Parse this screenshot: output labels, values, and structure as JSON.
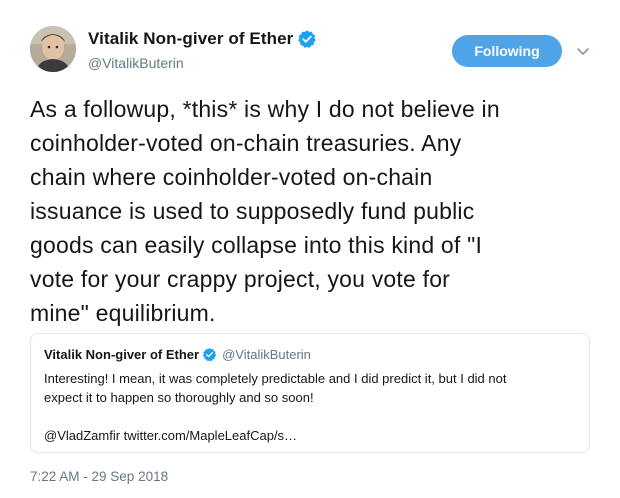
{
  "author": {
    "display_name": "Vitalik Non-giver of Ether",
    "handle": "@VitalikButerin",
    "verified": true
  },
  "follow_button": {
    "label": "Following",
    "color": "#4ea4e7"
  },
  "tweet": {
    "lines": [
      "As a followup, *this* is why I do not believe in",
      "coinholder-voted on-chain treasuries. Any",
      "chain where coinholder-voted on-chain",
      "issuance is used to supposedly fund public",
      "goods can easily collapse into this kind of \"I",
      "vote for your crappy project, you vote for",
      "mine\" equilibrium."
    ]
  },
  "quoted_tweet": {
    "display_name": "Vitalik Non-giver of Ether",
    "handle": "@VitalikButerin",
    "lines": [
      "Interesting! I mean, it was completely predictable and I did predict it,  but I did not",
      "expect it to happen so thoroughly and so soon!"
    ],
    "link_line": "@VladZamfir twitter.com/MapleLeafCap/s…"
  },
  "timestamp": "7:22 AM - 29 Sep 2018",
  "colors": {
    "text": "#14171a",
    "muted": "#657786",
    "accent": "#1da1f2",
    "border": "#e1e8ed"
  },
  "icons": [
    "verified-badge-icon",
    "chevron-down-icon",
    "avatar"
  ]
}
